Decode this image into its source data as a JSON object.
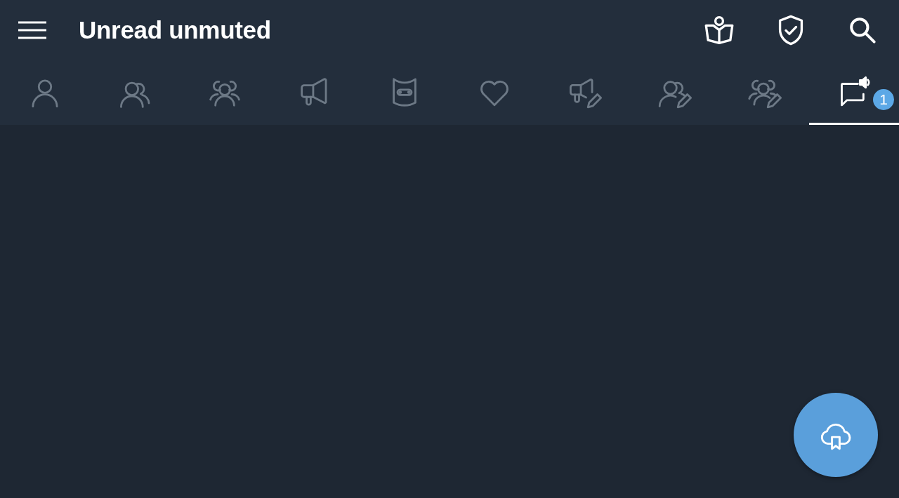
{
  "top_bar": {
    "menu": {
      "kind": "menu"
    },
    "title": "Unread unmuted",
    "actions": [
      {
        "kind": "reader"
      },
      {
        "kind": "shield-check"
      },
      {
        "kind": "search"
      }
    ]
  },
  "tabs": [
    {
      "kind": "user",
      "selected": false
    },
    {
      "kind": "users",
      "selected": false
    },
    {
      "kind": "group",
      "selected": false
    },
    {
      "kind": "megaphone",
      "selected": false
    },
    {
      "kind": "bot",
      "selected": false
    },
    {
      "kind": "heart",
      "selected": false
    },
    {
      "kind": "megaphone-edit",
      "selected": false
    },
    {
      "kind": "users-edit",
      "selected": false
    },
    {
      "kind": "group-edit",
      "selected": false
    },
    {
      "kind": "chat-sound",
      "selected": true,
      "badge": "1"
    }
  ],
  "fab": {
    "kind": "cloud-bookmark"
  }
}
